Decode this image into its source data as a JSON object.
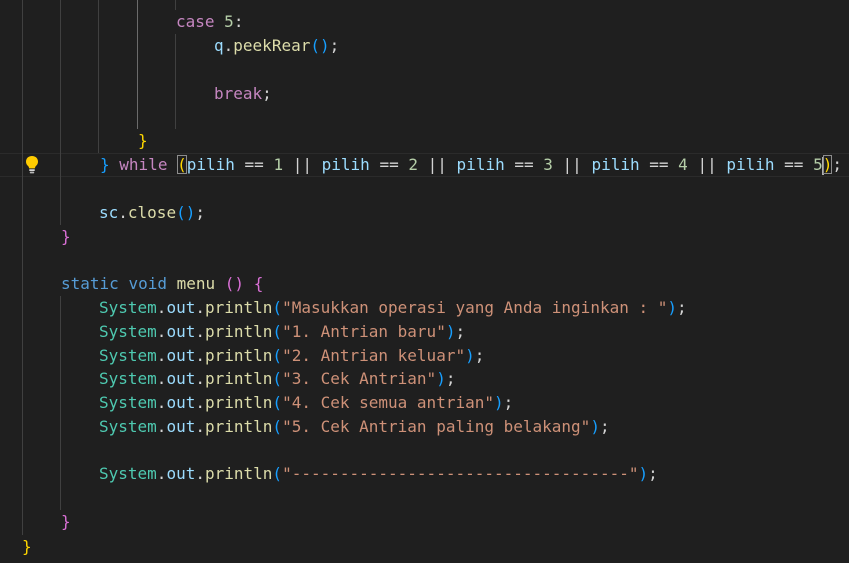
{
  "code": {
    "case_kw": "case",
    "case_value": "5",
    "colon": ":",
    "q_var": "q",
    "dot": ".",
    "peek_rear": "peekRear",
    "break_kw": "break",
    "semicolon": ";",
    "close_brace": "}",
    "open_brace": "{",
    "while_kw": "while",
    "pilih": "pilih",
    "eq_op": "==",
    "or_op": "||",
    "n1": "1",
    "n2": "2",
    "n3": "3",
    "n4": "4",
    "n5": "5",
    "sc_var": "sc",
    "close_fn": "close",
    "static_kw": "static",
    "void_kw": "void",
    "menu_fn": "menu",
    "system_cls": "System",
    "out_var": "out",
    "println_fn": "println",
    "open_paren": "(",
    "close_paren": ")",
    "strings": [
      "\"Masukkan operasi yang Anda inginkan : \"",
      "\"1. Antrian baru\"",
      "\"2. Antrian keluar\"",
      "\"3. Cek Antrian\"",
      "\"4. Cek semua antrian\"",
      "\"5. Cek Antrian paling belakang\"",
      "\"-----------------------------------\""
    ]
  },
  "colors": {
    "background": "#1f1f1f",
    "keyword_control": "#c586c0",
    "keyword_storage": "#569cd6",
    "function": "#dcdcaa",
    "variable": "#9cdcfe",
    "class": "#4ec9b0",
    "number": "#b5cea8",
    "string": "#ce9178",
    "bracket_level_1": "#ffd700",
    "bracket_level_2": "#da70d6",
    "bracket_level_3": "#179fff"
  },
  "icons": {
    "gutter": "lightbulb-icon"
  }
}
